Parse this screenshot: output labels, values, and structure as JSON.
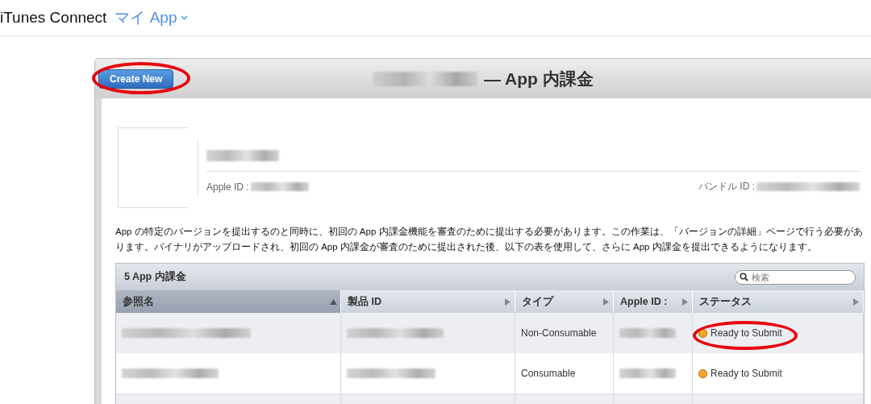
{
  "header": {
    "brand": "iTunes Connect",
    "nav_menu": "マイ App"
  },
  "panel": {
    "create_button": {
      "label": "Create New",
      "circled": true
    },
    "title": "— App 内課金"
  },
  "app_info": {
    "apple_id_label": "Apple ID :",
    "bundle_id_label": "バンドル ID :"
  },
  "description": "App の特定のバージョンを提出するのと同時に、初回の App 内課金機能を審査のために提出する必要があります。この作業は、「バージョンの詳細」ページで行う必要があります。バイナリがアップロードされ、初回の App 内課金が審査のために提出された後、以下の表を使用して、さらに App 内課金を提出できるようになります。",
  "table": {
    "title": "5 App 内課金",
    "search": {
      "placeholder": "検索"
    },
    "columns": [
      {
        "label": "参照名",
        "sorted": true
      },
      {
        "label": "製品 ID",
        "sorted": false
      },
      {
        "label": "タイプ",
        "sorted": false
      },
      {
        "label": "Apple ID :",
        "sorted": false
      },
      {
        "label": "ステータス",
        "sorted": false
      }
    ],
    "rows": [
      {
        "type": "Non-Consumable",
        "status": "Ready to Submit",
        "color": "#f5a623",
        "circled": true
      },
      {
        "type": "Consumable",
        "status": "Ready to Submit",
        "color": "#f5a623",
        "circled": false
      }
    ]
  }
}
